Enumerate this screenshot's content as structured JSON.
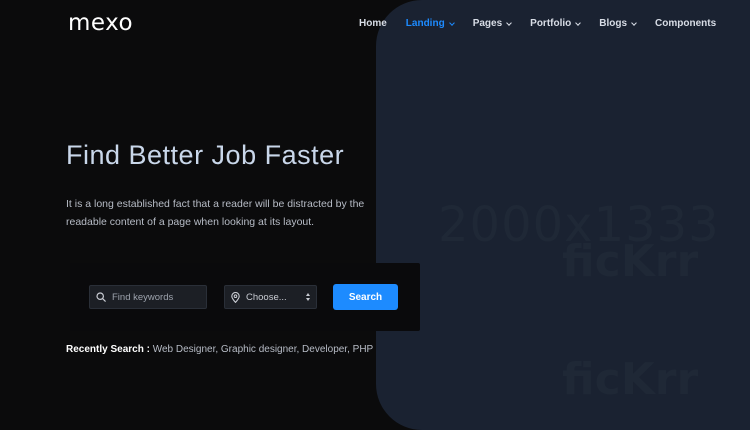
{
  "brand": {
    "logo_text": "mexo"
  },
  "nav": {
    "items": [
      {
        "label": "Home",
        "dropdown": false,
        "active": false
      },
      {
        "label": "Landing",
        "dropdown": true,
        "active": true
      },
      {
        "label": "Pages",
        "dropdown": true,
        "active": false
      },
      {
        "label": "Portfolio",
        "dropdown": true,
        "active": false
      },
      {
        "label": "Blogs",
        "dropdown": true,
        "active": false
      },
      {
        "label": "Components",
        "dropdown": false,
        "active": false
      }
    ]
  },
  "hero": {
    "title": "Find Better Job Faster",
    "description": "It is a long established fact that a reader will be distracted by the readable content of a page when looking at its layout."
  },
  "search": {
    "keywords_placeholder": "Find keywords",
    "keywords_icon": "search-icon",
    "location_value": "Choose...",
    "location_icon": "map-pin-icon",
    "button_label": "Search"
  },
  "recent": {
    "label": "Recently Search :",
    "terms": "Web Designer, Graphic designer, Developer, PHP"
  },
  "image_placeholder": {
    "dimensions": "2000x1333",
    "brand_mark": "ficKrr"
  },
  "colors": {
    "accent": "#1d8bff",
    "background": "#0b0b0c",
    "image_panel": "#1a2231"
  }
}
